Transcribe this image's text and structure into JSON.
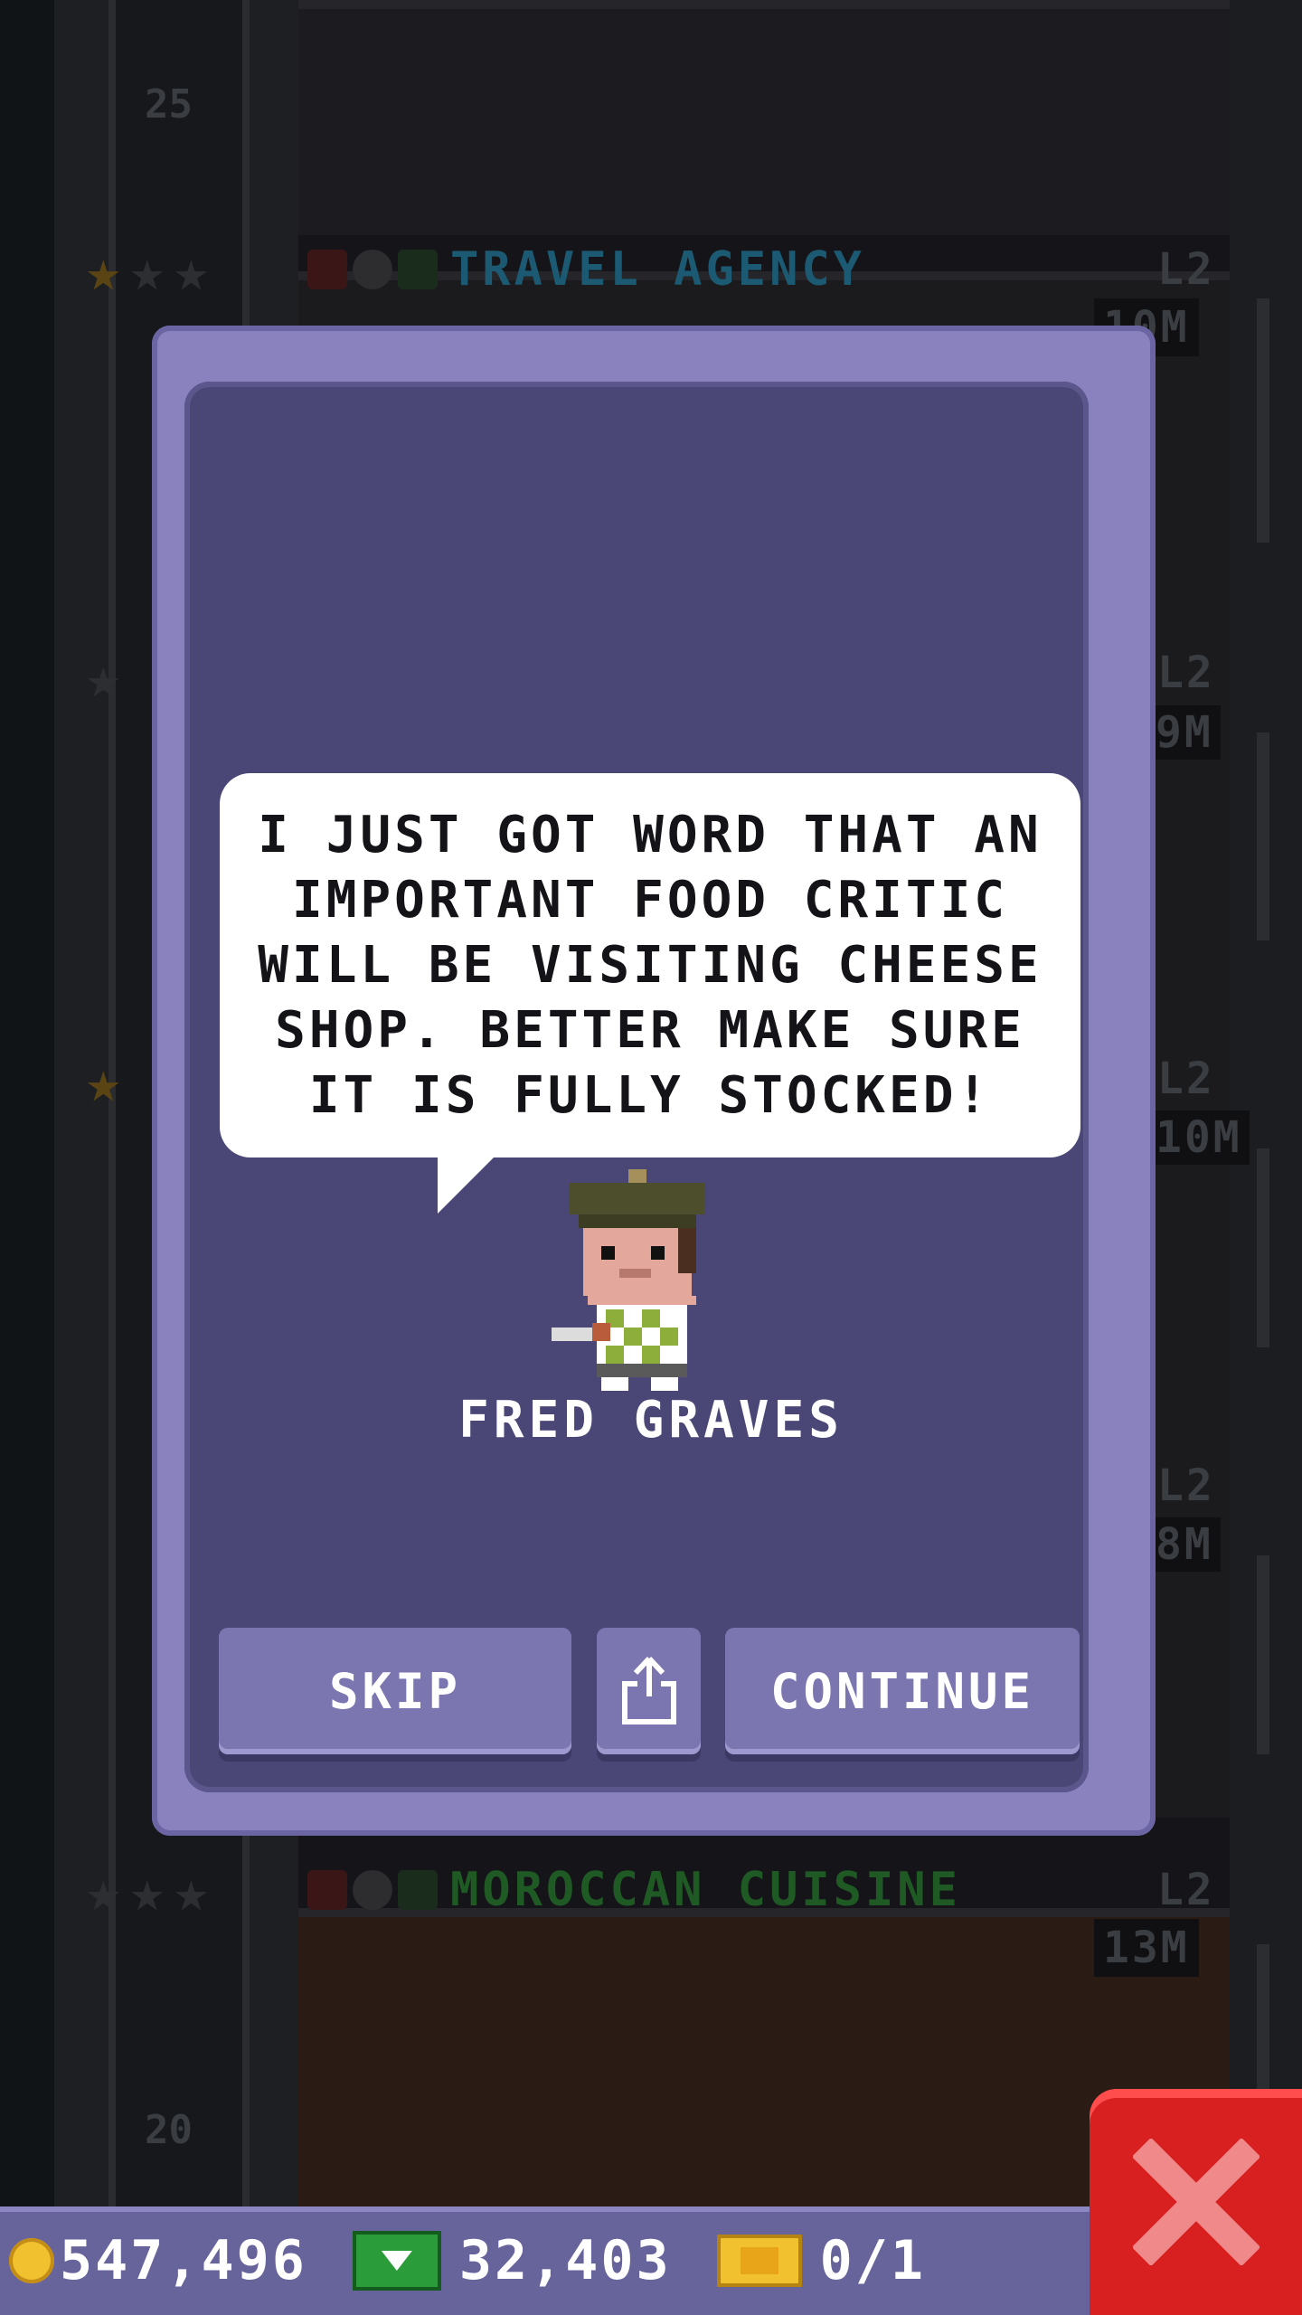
{
  "background": {
    "floors": [
      {
        "number": "25"
      },
      {
        "name": "TRAVEL AGENCY",
        "level": "L2",
        "cost": "10M",
        "stars_filled": 1,
        "stars_total": 3,
        "name_color": "#1b5a72"
      },
      {
        "name": "MOROCCAN CUISINE",
        "level": "L2",
        "cost": "13M",
        "stars_filled": 0,
        "stars_total": 3,
        "name_color": "#1f5a25"
      },
      {
        "number": "20"
      }
    ],
    "side_labels": [
      {
        "level": "L2",
        "cost": "9M"
      },
      {
        "level": "L2",
        "cost": "10M"
      },
      {
        "level": "L2",
        "cost": "8M"
      }
    ]
  },
  "dialog": {
    "message": "I JUST GOT WORD THAT AN IMPORTANT FOOD CRITIC WILL BE VISITING CHEESE SHOP. BETTER MAKE SURE IT IS FULLY STOCKED!",
    "character_name": "FRED GRAVES",
    "buttons": {
      "skip": "SKIP",
      "continue": "CONTINUE",
      "share_icon": "share-icon"
    }
  },
  "hud": {
    "coins": "547,496",
    "bux": "32,403",
    "tickets": "0/1",
    "coin_icon": "coin-icon",
    "bux_icon": "bux-icon",
    "ticket_icon": "ticket-icon"
  },
  "colors": {
    "dialog_frame": "#8a82bf",
    "dialog_inner": "#4a4776",
    "hud_bar": "#67639b",
    "close_button": "#d82020"
  }
}
